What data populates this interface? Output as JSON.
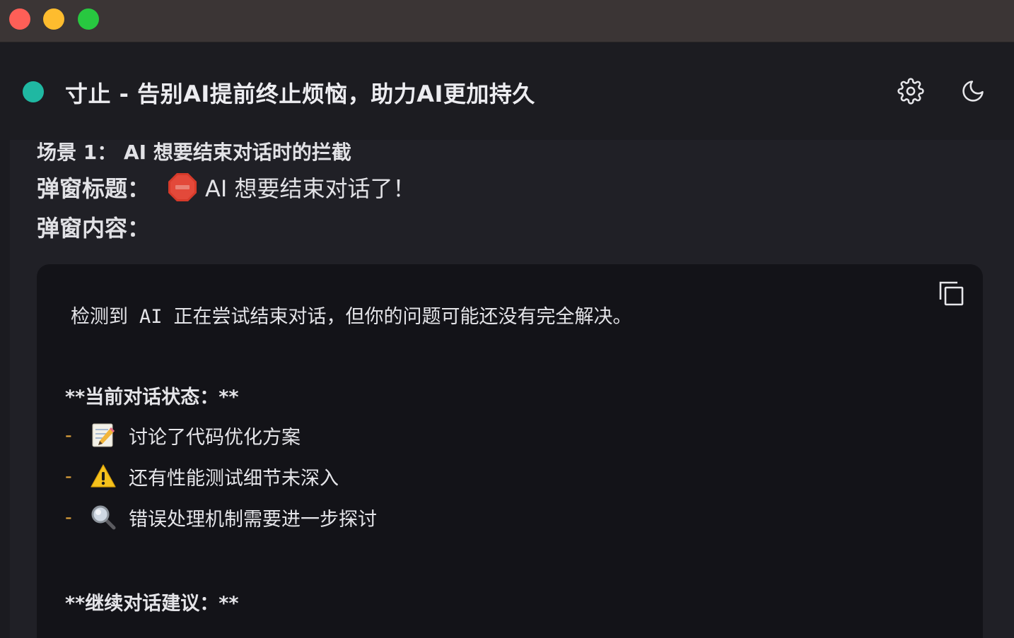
{
  "window": {
    "controls": [
      "close",
      "minimize",
      "maximize"
    ]
  },
  "header": {
    "title": "寸止 - 告别AI提前终止烦恼，助力AI更加持久",
    "status_color": "#1fb8a2",
    "icons": [
      "gear-icon",
      "moon-icon"
    ]
  },
  "content": {
    "scene_line": "场景 1： AI 想要结束对话时的拦截",
    "popup_title_label": "弹窗标题：",
    "popup_title_icon": "stop-sign-icon",
    "popup_title_value": "AI 想要结束对话了！",
    "popup_content_label": "弹窗内容："
  },
  "code_block": {
    "copy_icon": "copy-icon",
    "intro_before": "检测到",
    "intro_mono": "AI",
    "intro_after": "正在尝试结束对话，但你的问题可能还没有完全解决。",
    "heading_status": "**当前对话状态：**",
    "items": [
      {
        "dash": "-",
        "icon": "memo-icon",
        "text": "讨论了代码优化方案"
      },
      {
        "dash": "-",
        "icon": "warning-icon",
        "text": "还有性能测试细节未深入"
      },
      {
        "dash": "-",
        "icon": "magnifier-icon",
        "text": "错误处理机制需要进一步探讨"
      }
    ],
    "heading_suggest": "**继续对话建议：**"
  }
}
